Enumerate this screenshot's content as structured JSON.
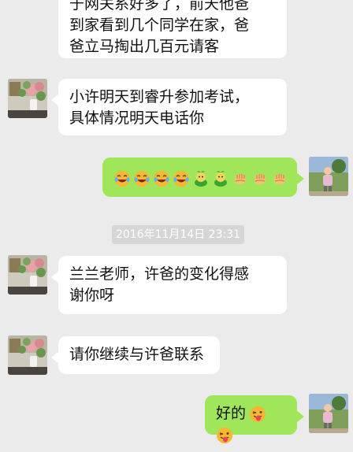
{
  "messages": [
    {
      "side": "in",
      "lines": [
        "于网关系好多了，前天他爸",
        "到家看到几个同学在家，爸",
        "爸立马掏出几百元请客"
      ]
    },
    {
      "side": "in",
      "lines": [
        "小许明天到睿升参加考试，",
        "具体情况明天电话你"
      ]
    },
    {
      "side": "out",
      "emojis": [
        "laugh-tears-icon",
        "laugh-tears-icon",
        "laugh-tears-icon",
        "laugh-tears-icon",
        "green-sprout-icon",
        "green-sprout-icon",
        "fist-icon",
        "fist-icon",
        "fist-icon"
      ]
    },
    {
      "side": "in",
      "lines": [
        "兰兰老师，许爸的变化得感",
        "谢你呀"
      ]
    },
    {
      "side": "in",
      "lines": [
        "请你继续与许爸联系"
      ]
    },
    {
      "side": "out",
      "text": "好的",
      "emojis": [
        "tongue-out-face-icon",
        "tongue-out-face-icon"
      ]
    }
  ],
  "timestamp": "2016年11月14日 23:31",
  "colors": {
    "background": "#ebebeb",
    "incoming_bubble": "#ffffff",
    "outgoing_bubble": "#9fe65a",
    "timestamp_bg": "#d6d6d6"
  }
}
